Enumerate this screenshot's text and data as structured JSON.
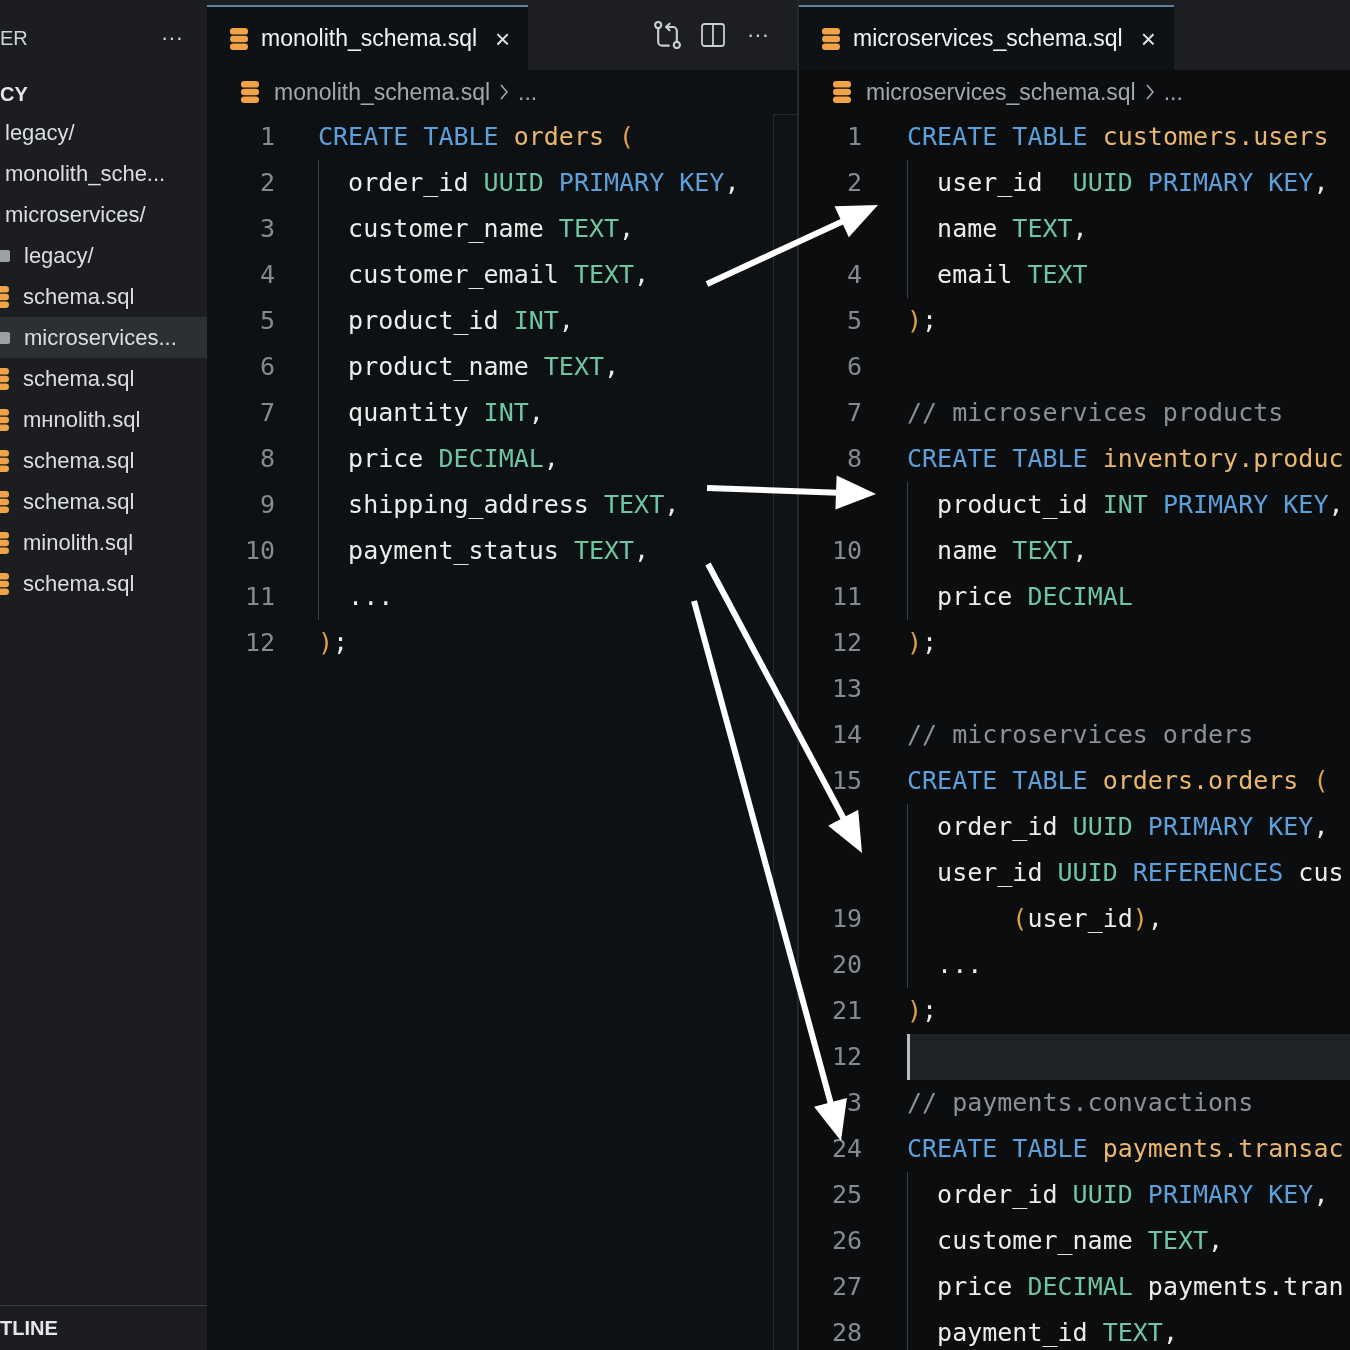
{
  "sidebar": {
    "title": "ER",
    "menu": "···",
    "section": "CY",
    "items": [
      {
        "label": "legacy/",
        "kind": "plain",
        "selected": false
      },
      {
        "label": "monolith_sche...",
        "kind": "plain",
        "selected": false
      },
      {
        "label": "microservices/",
        "kind": "plain",
        "selected": false
      },
      {
        "label": "legacy/",
        "kind": "folder",
        "selected": false
      },
      {
        "label": "schema.sql",
        "kind": "sql",
        "selected": false
      },
      {
        "label": "microservices...",
        "kind": "folder",
        "selected": true
      },
      {
        "label": "schema.sql",
        "kind": "sql",
        "selected": false
      },
      {
        "label": "mнnolith.sql",
        "kind": "sql",
        "selected": false
      },
      {
        "label": "schema.sql",
        "kind": "sql",
        "selected": false
      },
      {
        "label": "schema.sql",
        "kind": "sql",
        "selected": false
      },
      {
        "label": "minolith.sql",
        "kind": "sql",
        "selected": false
      },
      {
        "label": "schema.sql",
        "kind": "sql",
        "selected": false
      }
    ],
    "footer": "TLINE"
  },
  "editors": [
    {
      "tab": {
        "label": "monolith_schema.sql",
        "close": "×",
        "selected": true
      },
      "actions": [
        {
          "kind": "compare"
        },
        {
          "kind": "split"
        },
        {
          "kind": "more",
          "label": "···"
        }
      ],
      "breadcrumb": {
        "file": "monolith_schema.sql",
        "more": "..."
      },
      "lines": [
        {
          "number": "1",
          "guide": false,
          "current": false,
          "tokens": [
            {
              "kind": "keyword",
              "text": "CREATE TABLE "
            },
            {
              "kind": "name",
              "text": "orders "
            },
            {
              "kind": "paren",
              "text": "("
            }
          ]
        },
        {
          "number": "2",
          "guide": true,
          "current": false,
          "tokens": [
            {
              "kind": "plain",
              "text": "  order_id "
            },
            {
              "kind": "type",
              "text": "UUID "
            },
            {
              "kind": "keyword",
              "text": "PRIMARY KEY"
            },
            {
              "kind": "plain",
              "text": ","
            }
          ]
        },
        {
          "number": "3",
          "guide": true,
          "current": false,
          "tokens": [
            {
              "kind": "plain",
              "text": "  customer_name "
            },
            {
              "kind": "type",
              "text": "TEXT"
            },
            {
              "kind": "plain",
              "text": ","
            }
          ]
        },
        {
          "number": "4",
          "guide": true,
          "current": false,
          "tokens": [
            {
              "kind": "plain",
              "text": "  customer_email "
            },
            {
              "kind": "type",
              "text": "TEXT"
            },
            {
              "kind": "plain",
              "text": ","
            }
          ]
        },
        {
          "number": "5",
          "guide": true,
          "current": false,
          "tokens": [
            {
              "kind": "plain",
              "text": "  product_id "
            },
            {
              "kind": "type",
              "text": "INT"
            },
            {
              "kind": "plain",
              "text": ","
            }
          ]
        },
        {
          "number": "6",
          "guide": true,
          "current": false,
          "tokens": [
            {
              "kind": "plain",
              "text": "  product_name "
            },
            {
              "kind": "type",
              "text": "TEXT"
            },
            {
              "kind": "plain",
              "text": ","
            }
          ]
        },
        {
          "number": "7",
          "guide": true,
          "current": false,
          "tokens": [
            {
              "kind": "plain",
              "text": "  quantity "
            },
            {
              "kind": "type",
              "text": "INT"
            },
            {
              "kind": "plain",
              "text": ","
            }
          ]
        },
        {
          "number": "8",
          "guide": true,
          "current": false,
          "tokens": [
            {
              "kind": "plain",
              "text": "  price "
            },
            {
              "kind": "type",
              "text": "DECIMAL"
            },
            {
              "kind": "plain",
              "text": ","
            }
          ]
        },
        {
          "number": "9",
          "guide": true,
          "current": false,
          "tokens": [
            {
              "kind": "plain",
              "text": "  shipping_address "
            },
            {
              "kind": "type",
              "text": "TEXT"
            },
            {
              "kind": "plain",
              "text": ","
            }
          ]
        },
        {
          "number": "10",
          "guide": true,
          "current": false,
          "tokens": [
            {
              "kind": "plain",
              "text": "  payment_status "
            },
            {
              "kind": "type",
              "text": "TEXT"
            },
            {
              "kind": "plain",
              "text": ","
            }
          ]
        },
        {
          "number": "11",
          "guide": true,
          "current": false,
          "tokens": [
            {
              "kind": "plain",
              "text": "  ..."
            }
          ]
        },
        {
          "number": "12",
          "guide": false,
          "current": false,
          "tokens": [
            {
              "kind": "paren",
              "text": ")"
            },
            {
              "kind": "plain",
              "text": ";"
            }
          ]
        }
      ]
    },
    {
      "tab": {
        "label": "microservices_schema.sql",
        "close": "×",
        "selected": true
      },
      "breadcrumb": {
        "file": "microservices_schema.sql",
        "more": "..."
      },
      "lines": [
        {
          "number": "1",
          "guide": false,
          "current": false,
          "tokens": [
            {
              "kind": "keyword",
              "text": "CREATE TABLE "
            },
            {
              "kind": "name",
              "text": "customers.users"
            }
          ]
        },
        {
          "number": "2",
          "guide": true,
          "current": false,
          "tokens": [
            {
              "kind": "plain",
              "text": "  user_id  "
            },
            {
              "kind": "type",
              "text": "UUID "
            },
            {
              "kind": "keyword",
              "text": "PRIMARY KEY"
            },
            {
              "kind": "plain",
              "text": ","
            }
          ]
        },
        {
          "guide": true,
          "current": false,
          "tokens": [
            {
              "kind": "plain",
              "text": "  name "
            },
            {
              "kind": "type",
              "text": "TEXT"
            },
            {
              "kind": "plain",
              "text": ","
            }
          ]
        },
        {
          "number": "4",
          "guide": true,
          "current": false,
          "tokens": [
            {
              "kind": "plain",
              "text": "  email "
            },
            {
              "kind": "type",
              "text": "TEXT"
            }
          ]
        },
        {
          "number": "5",
          "guide": false,
          "current": false,
          "tokens": [
            {
              "kind": "paren",
              "text": ")"
            },
            {
              "kind": "plain",
              "text": ";"
            }
          ]
        },
        {
          "number": "6",
          "guide": false,
          "current": false
        },
        {
          "number": "7",
          "guide": false,
          "current": false,
          "tokens": [
            {
              "kind": "comment",
              "text": "// microservices products"
            }
          ]
        },
        {
          "number": "8",
          "guide": false,
          "current": false,
          "tokens": [
            {
              "kind": "keyword",
              "text": "CREATE TABLE "
            },
            {
              "kind": "name",
              "text": "inventory.produc"
            }
          ]
        },
        {
          "guide": true,
          "current": false,
          "tokens": [
            {
              "kind": "plain",
              "text": "  product_id "
            },
            {
              "kind": "type",
              "text": "INT "
            },
            {
              "kind": "keyword",
              "text": "PRIMARY KEY"
            },
            {
              "kind": "plain",
              "text": ","
            }
          ]
        },
        {
          "number": "10",
          "guide": true,
          "current": false,
          "tokens": [
            {
              "kind": "plain",
              "text": "  name "
            },
            {
              "kind": "type",
              "text": "TEXT"
            },
            {
              "kind": "plain",
              "text": ","
            }
          ]
        },
        {
          "number": "11",
          "guide": true,
          "current": false,
          "tokens": [
            {
              "kind": "plain",
              "text": "  price "
            },
            {
              "kind": "type",
              "text": "DECIMAL"
            }
          ]
        },
        {
          "number": "12",
          "guide": false,
          "current": false,
          "tokens": [
            {
              "kind": "paren",
              "text": ")"
            },
            {
              "kind": "plain",
              "text": ";"
            }
          ]
        },
        {
          "number": "13",
          "guide": false,
          "current": false
        },
        {
          "number": "14",
          "guide": false,
          "current": false,
          "tokens": [
            {
              "kind": "comment",
              "text": "// microservices orders"
            }
          ]
        },
        {
          "number": "15",
          "guide": false,
          "current": false,
          "tokens": [
            {
              "kind": "keyword",
              "text": "CREATE TABLE "
            },
            {
              "kind": "name",
              "text": "orders.orders "
            },
            {
              "kind": "paren",
              "text": "("
            }
          ]
        },
        {
          "guide": true,
          "current": false,
          "tokens": [
            {
              "kind": "plain",
              "text": "  order_id "
            },
            {
              "kind": "type",
              "text": "UUID "
            },
            {
              "kind": "keyword",
              "text": "PRIMARY KEY"
            },
            {
              "kind": "plain",
              "text": ","
            }
          ]
        },
        {
          "guide": true,
          "current": false,
          "tokens": [
            {
              "kind": "plain",
              "text": "  user_id "
            },
            {
              "kind": "type",
              "text": "UUID "
            },
            {
              "kind": "keyword",
              "text": "REFERENCES "
            },
            {
              "kind": "plain",
              "text": "cus"
            }
          ]
        },
        {
          "number": "19",
          "guide": true,
          "current": false,
          "tokens": [
            {
              "kind": "paren",
              "text": "       ("
            },
            {
              "kind": "plain",
              "text": "user_id"
            },
            {
              "kind": "paren",
              "text": ")"
            },
            {
              "kind": "plain",
              "text": ","
            }
          ]
        },
        {
          "number": "20",
          "guide": true,
          "current": false,
          "tokens": [
            {
              "kind": "plain",
              "text": "  ..."
            }
          ]
        },
        {
          "number": "21",
          "guide": false,
          "current": false,
          "tokens": [
            {
              "kind": "paren",
              "text": ")"
            },
            {
              "kind": "plain",
              "text": ";"
            }
          ]
        },
        {
          "number": "12",
          "guide": false,
          "current": true
        },
        {
          "number": "3",
          "guide": false,
          "current": false,
          "tokens": [
            {
              "kind": "comment",
              "text": "// payments.convactions"
            }
          ]
        },
        {
          "number": "24",
          "guide": false,
          "current": false,
          "tokens": [
            {
              "kind": "keyword",
              "text": "CREATE TABLE "
            },
            {
              "kind": "name",
              "text": "payments.transac"
            }
          ]
        },
        {
          "number": "25",
          "guide": true,
          "current": false,
          "tokens": [
            {
              "kind": "plain",
              "text": "  order_id "
            },
            {
              "kind": "type",
              "text": "UUID "
            },
            {
              "kind": "keyword",
              "text": "PRIMARY KEY"
            },
            {
              "kind": "plain",
              "text": ","
            }
          ]
        },
        {
          "number": "26",
          "guide": true,
          "current": false,
          "tokens": [
            {
              "kind": "plain",
              "text": "  customer_name "
            },
            {
              "kind": "type",
              "text": "TEXT"
            },
            {
              "kind": "plain",
              "text": ","
            }
          ]
        },
        {
          "number": "27",
          "guide": true,
          "current": false,
          "tokens": [
            {
              "kind": "plain",
              "text": "  price "
            },
            {
              "kind": "type",
              "text": "DECIMAL "
            },
            {
              "kind": "plain",
              "text": "payments.tran"
            }
          ]
        },
        {
          "number": "28",
          "guide": true,
          "current": false,
          "tokens": [
            {
              "kind": "plain",
              "text": "  payment_id "
            },
            {
              "kind": "type",
              "text": "TEXT"
            },
            {
              "kind": "plain",
              "text": ","
            }
          ]
        }
      ]
    }
  ]
}
